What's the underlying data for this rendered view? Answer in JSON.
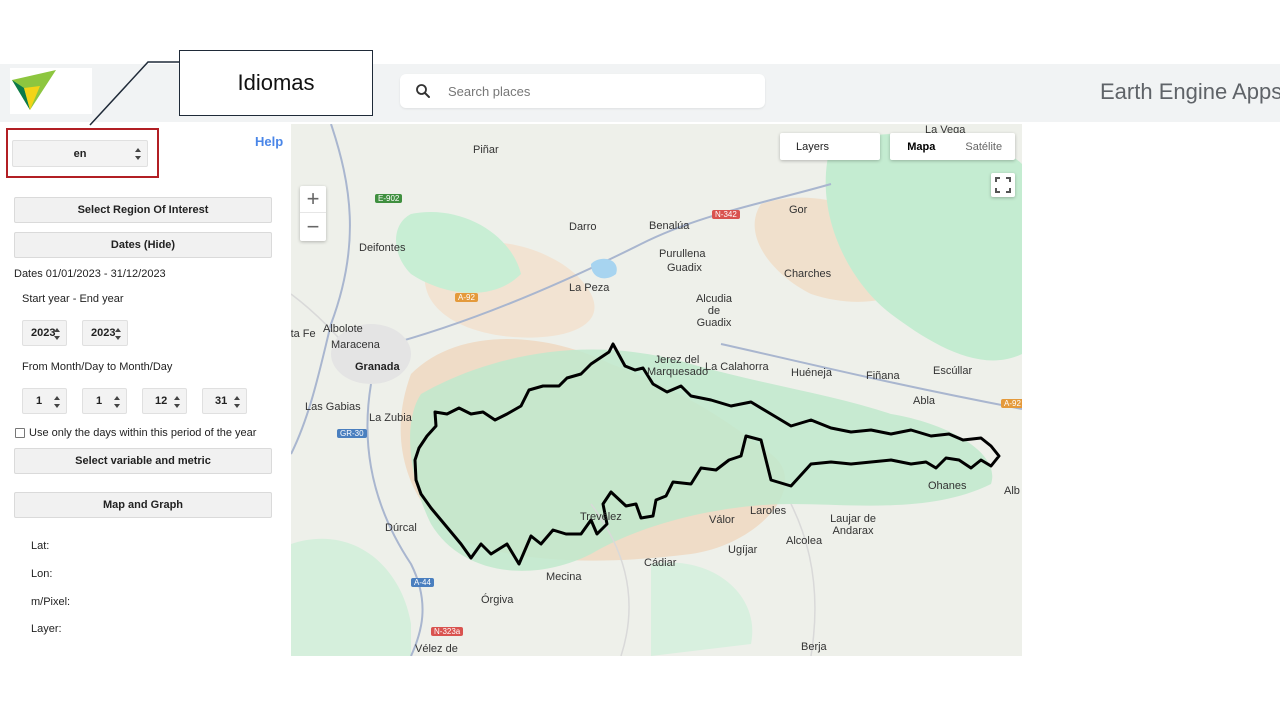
{
  "header": {
    "search_placeholder": "Search places",
    "brand": "Earth Engine Apps"
  },
  "callout": {
    "label": "Idiomas"
  },
  "panel": {
    "language_value": "en",
    "help_label": "Help",
    "select_region_button": "Select Region Of Interest",
    "dates_button": "Dates (Hide)",
    "dates_range": "Dates 01/01/2023 - 31/12/2023",
    "year_label": "Start year - End year",
    "start_year": "2023",
    "end_year": "2023",
    "monthday_label": "From Month/Day to Month/Day",
    "from_month": "1",
    "from_day": "1",
    "to_month": "12",
    "to_day": "31",
    "period_checkbox_label": "Use only the days within this period of the year",
    "select_variable_button": "Select variable and metric",
    "map_graph_button": "Map and Graph",
    "lat_label": "Lat:",
    "lon_label": "Lon:",
    "mpixel_label": "m/Pixel:",
    "layer_label": "Layer:"
  },
  "map": {
    "layers_label": "Layers",
    "maptype_map": "Mapa",
    "maptype_satellite": "Satélite",
    "zoom_in": "+",
    "zoom_out": "−",
    "places": [
      {
        "name": "Piñar"
      },
      {
        "name": "La Vega"
      },
      {
        "name": "Deifontes"
      },
      {
        "name": "Darro"
      },
      {
        "name": "Benalúa"
      },
      {
        "name": "Purullena"
      },
      {
        "name": "Guadix"
      },
      {
        "name": "Gor"
      },
      {
        "name": "Charches"
      },
      {
        "name": "La Peza"
      },
      {
        "name": "Alcudia de Guadix"
      },
      {
        "name": "Albolote"
      },
      {
        "name": "Maracena"
      },
      {
        "name": "Granada"
      },
      {
        "name": "Jerez del Marquesado"
      },
      {
        "name": "La Calahorra"
      },
      {
        "name": "Huéneja"
      },
      {
        "name": "Fiñana"
      },
      {
        "name": "Escúllar"
      },
      {
        "name": "Las Gabias"
      },
      {
        "name": "La Zubia"
      },
      {
        "name": "Abla"
      },
      {
        "name": "Ohanes"
      },
      {
        "name": "Alb"
      },
      {
        "name": "Dúrcal"
      },
      {
        "name": "Trevélez"
      },
      {
        "name": "Válor"
      },
      {
        "name": "Laroles"
      },
      {
        "name": "Laujar de Andarax"
      },
      {
        "name": "Alcolea"
      },
      {
        "name": "Ugíjar"
      },
      {
        "name": "Cádiar"
      },
      {
        "name": "Mecina"
      },
      {
        "name": "Órgiva"
      },
      {
        "name": "Vélez de"
      },
      {
        "name": "Berja"
      },
      {
        "name": "Santa Fe"
      }
    ],
    "roads": [
      "E-902",
      "N-342",
      "A-92",
      "GR-30",
      "A-44",
      "N-323a",
      "N-342",
      "A-92"
    ]
  },
  "colors": {
    "accent": "#4a86e8",
    "highlight": "#b21f24",
    "forest": "#c4ecd1",
    "relief": "#efdcc7",
    "boundary": "#000000"
  }
}
